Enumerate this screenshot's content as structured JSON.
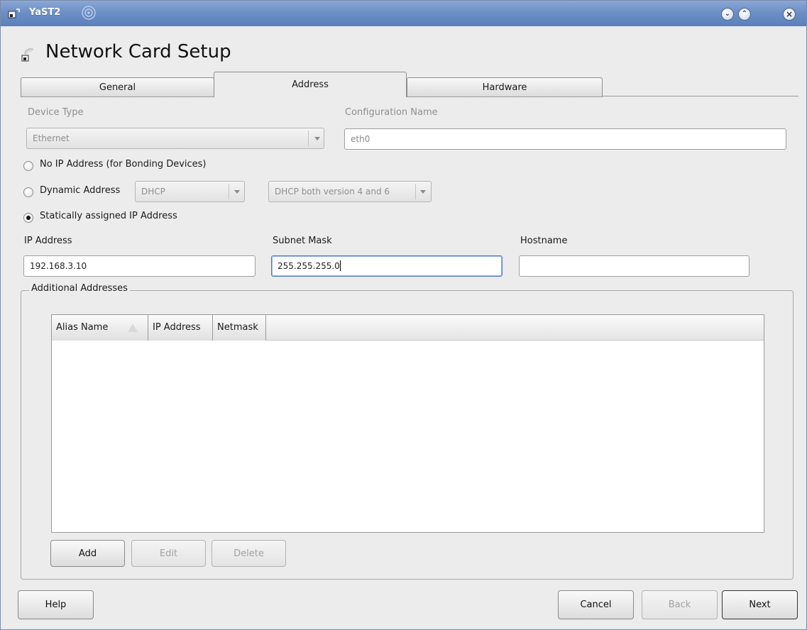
{
  "window": {
    "title": "YaST2",
    "controls": {
      "minimize_icon": "chevron-down-icon",
      "maximize_icon": "chevron-up-icon",
      "close_icon": "close-icon"
    }
  },
  "header": {
    "title": "Network Card Setup"
  },
  "tabs": [
    {
      "label": "General",
      "active": false
    },
    {
      "label": "Address",
      "active": true
    },
    {
      "label": "Hardware",
      "active": false
    }
  ],
  "device_type": {
    "label": "Device Type",
    "value": "Ethernet"
  },
  "configuration_name": {
    "label": "Configuration Name",
    "value": "eth0"
  },
  "options": {
    "no_ip": {
      "label": "No IP Address (for Bonding Devices)",
      "selected": false
    },
    "dynamic": {
      "label": "Dynamic Address",
      "selected": false,
      "method": "DHCP",
      "version": "DHCP both version 4 and 6"
    },
    "static": {
      "label": "Statically assigned IP Address",
      "selected": true
    }
  },
  "ip_address": {
    "label": "IP Address",
    "value": "192.168.3.10"
  },
  "subnet_mask": {
    "label": "Subnet Mask",
    "value": "255.255.255.0"
  },
  "hostname": {
    "label": "Hostname",
    "value": ""
  },
  "additional_addresses": {
    "title": "Additional Addresses",
    "columns": [
      "Alias Name",
      "IP Address",
      "Netmask"
    ],
    "rows": [],
    "buttons": {
      "add": "Add",
      "edit": "Edit",
      "delete": "Delete"
    }
  },
  "footer": {
    "help": "Help",
    "cancel": "Cancel",
    "back": "Back",
    "next": "Next"
  },
  "colors": {
    "titlebar": "#6d8fc6",
    "focus": "#4f79c6",
    "background": "#ececec"
  }
}
